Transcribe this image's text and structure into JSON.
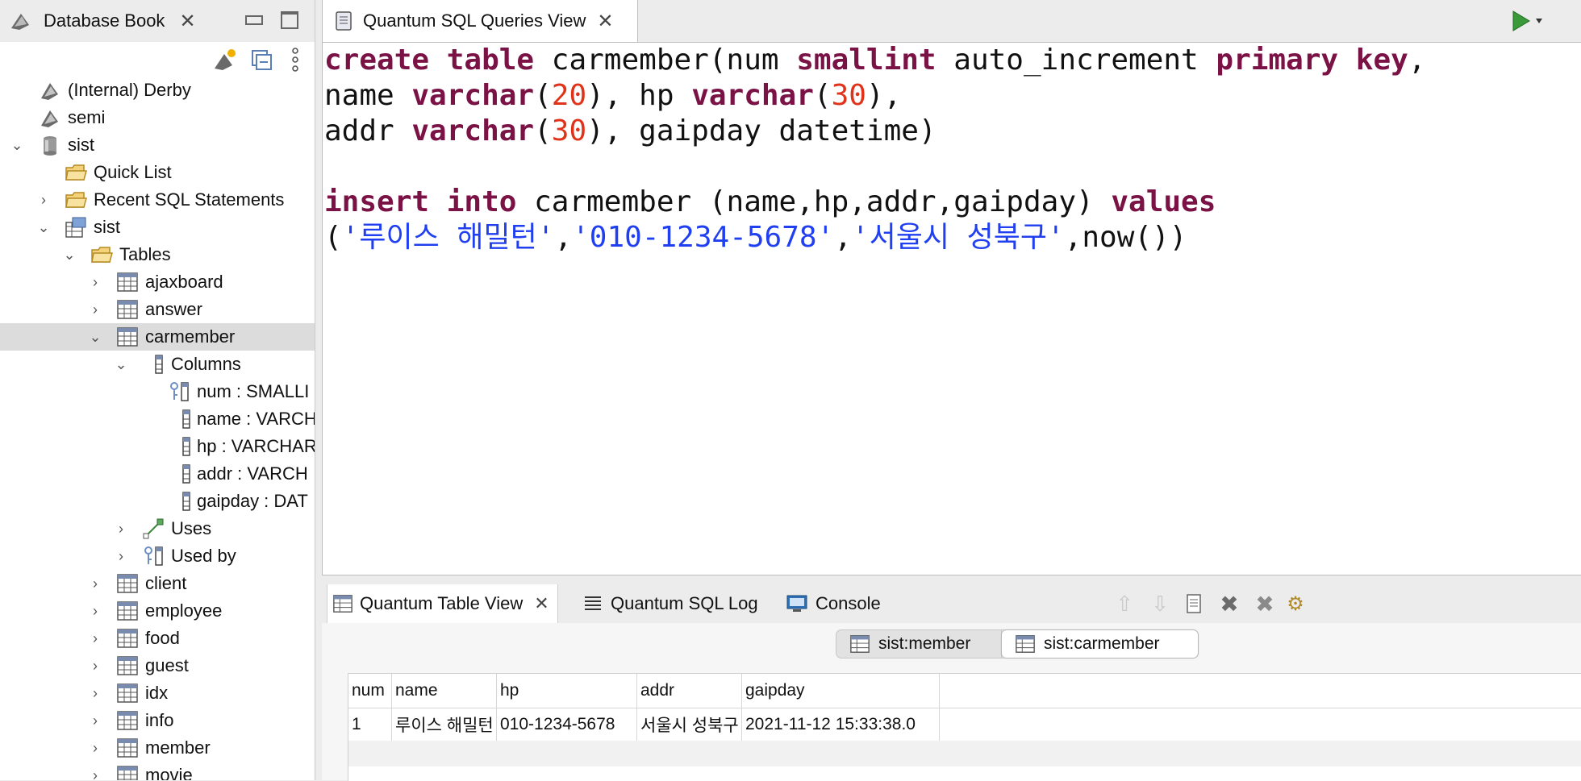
{
  "left_panel": {
    "tab_label": "Database Book",
    "tree": {
      "internal_derby": "(Internal) Derby",
      "semi": "semi",
      "sist_db": "sist",
      "quick_list": "Quick List",
      "recent_sql": "Recent SQL Statements",
      "sist_schema": "sist",
      "tables": "Tables",
      "ajaxboard": "ajaxboard",
      "answer": "answer",
      "carmember": "carmember",
      "columns": "Columns",
      "col_num": "num : SMALLI",
      "col_name": "name : VARCH",
      "col_hp": "hp : VARCHAR",
      "col_addr": "addr : VARCH",
      "col_gaipday": "gaipday : DAT",
      "uses": "Uses",
      "used_by": "Used by",
      "client": "client",
      "employee": "employee",
      "food": "food",
      "guest": "guest",
      "idx": "idx",
      "info": "info",
      "member": "member",
      "movie": "movie"
    }
  },
  "editor": {
    "tab_label": "Quantum SQL Queries View",
    "code": {
      "l1_create": "create",
      "l1_table": "table",
      "l1_name": " carmember(num ",
      "l1_smallint": "smallint",
      "l1_auto": " auto_increment ",
      "l1_primary": "primary",
      "l1_key": "key",
      "l1_end": ",",
      "l2_name": "name ",
      "l2_varchar1": "varchar",
      "l2_p1": "(",
      "l2_n1": "20",
      "l2_mid": "), hp ",
      "l2_varchar2": "varchar",
      "l2_p2": "(",
      "l2_n2": "30",
      "l2_end": "),",
      "l3_addr": "addr ",
      "l3_varchar": "varchar",
      "l3_p": "(",
      "l3_n": "30",
      "l3_end": "), gaipday datetime)",
      "l5_insert": "insert",
      "l5_into": "into",
      "l5_mid": " carmember (name,hp,addr,gaipday) ",
      "l5_values": "values",
      "l6_open": "(",
      "l6_s1": "'루이스 해밀턴'",
      "l6_c1": ",",
      "l6_s2": "'010-1234-5678'",
      "l6_c2": ",",
      "l6_s3": "'서울시 성북구'",
      "l6_end": ",now())"
    }
  },
  "bottom_panel": {
    "tabs": {
      "table_view": "Quantum Table View",
      "sql_log": "Quantum SQL Log",
      "console": "Console"
    },
    "segments": [
      "sist:member",
      "sist:carmember"
    ],
    "selected_segment": "sist:carmember",
    "grid": {
      "headers": [
        "num",
        "name",
        "hp",
        "addr",
        "gaipday"
      ],
      "rows": [
        [
          "1",
          "루이스 해밀턴",
          "010-1234-5678",
          "서울시 성북구",
          "2021-11-12 15:33:38.0"
        ]
      ]
    }
  },
  "colors": {
    "keyword": "#7b1246",
    "number": "#e0331a",
    "string": "#1f3ff0",
    "selection": "#dcdcdc"
  }
}
